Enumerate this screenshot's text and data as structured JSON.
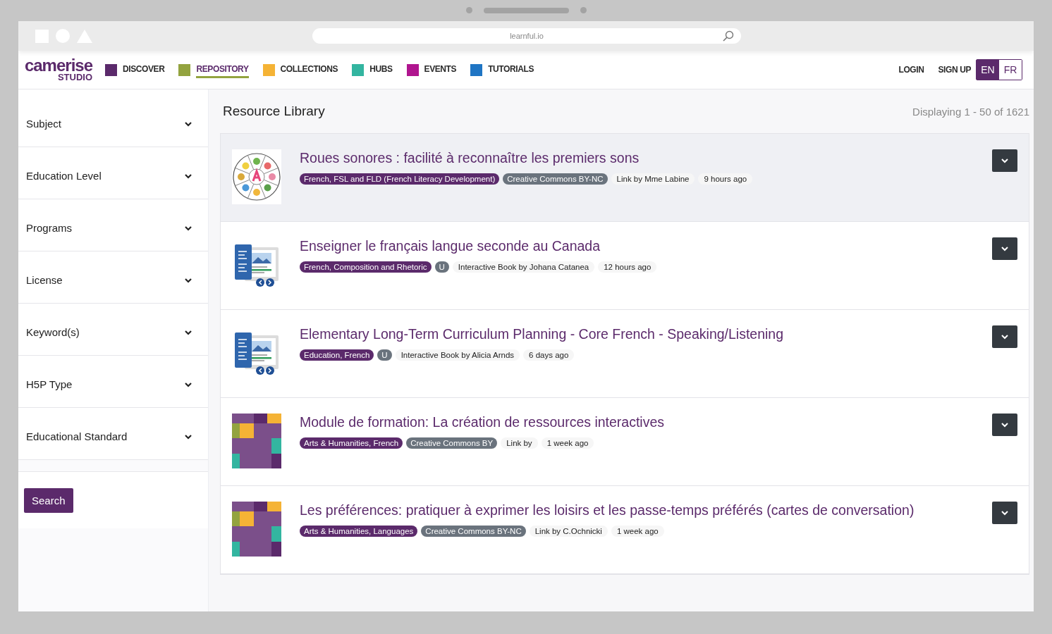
{
  "browser": {
    "address": "learnful.io"
  },
  "nav": {
    "logo": {
      "word": "camerise",
      "sub": "STUDIO"
    },
    "items": [
      {
        "label": "DISCOVER",
        "color": "#5b2a6b",
        "selected": false
      },
      {
        "label": "REPOSITORY",
        "color": "#93a33f",
        "selected": true
      },
      {
        "label": "COLLECTIONS",
        "color": "#f5b335",
        "selected": false
      },
      {
        "label": "HUBS",
        "color": "#33b5a0",
        "selected": false
      },
      {
        "label": "EVENTS",
        "color": "#b0158f",
        "selected": false
      },
      {
        "label": "TUTORIALS",
        "color": "#1f75c4",
        "selected": false
      }
    ],
    "account": [
      "LOGIN",
      "SIGN UP"
    ],
    "languages": [
      {
        "label": "EN",
        "selected": true
      },
      {
        "label": "FR",
        "selected": false
      }
    ]
  },
  "sidebar": {
    "filters": [
      "Subject",
      "Education Level",
      "Programs",
      "License",
      "Keyword(s)",
      "H5P Type",
      "Educational Standard"
    ],
    "button": "Search"
  },
  "main": {
    "title": "Resource Library",
    "count": "Displaying 1 - 50 of 1621",
    "results": [
      {
        "kind": "wheel",
        "highlighted": true,
        "title": "Roues sonores : facilité à reconnaître les premiers sons",
        "chips": [
          {
            "kind": "subject",
            "text": "French, FSL and FLD (French Literacy Development)"
          },
          {
            "kind": "license",
            "text": "Creative Commons BY-NC"
          },
          {
            "kind": "plain",
            "text": "Link by Mme Labine"
          },
          {
            "kind": "plain",
            "text": "9 hours ago"
          }
        ]
      },
      {
        "kind": "book",
        "highlighted": false,
        "title": "Enseigner le français langue seconde au Canada",
        "chips": [
          {
            "kind": "subject",
            "text": "French, Composition and Rhetoric"
          },
          {
            "kind": "license",
            "text": "U"
          },
          {
            "kind": "plain",
            "text": "Interactive Book by Johana Catanea"
          },
          {
            "kind": "plain",
            "text": "12 hours ago"
          }
        ]
      },
      {
        "kind": "book",
        "highlighted": false,
        "title": "Elementary Long-Term Curriculum Planning - Core French - Speaking/Listening",
        "chips": [
          {
            "kind": "subject",
            "text": "Education, French"
          },
          {
            "kind": "license",
            "text": "U"
          },
          {
            "kind": "plain",
            "text": "Interactive Book by Alicia Arnds"
          },
          {
            "kind": "plain",
            "text": "6 days ago"
          }
        ]
      },
      {
        "kind": "mosaic",
        "highlighted": false,
        "title": "Module de formation: La création de ressources interactives",
        "chips": [
          {
            "kind": "subject",
            "text": "Arts & Humanities, French"
          },
          {
            "kind": "license",
            "text": "Creative Commons BY"
          },
          {
            "kind": "plain",
            "text": "Link by"
          },
          {
            "kind": "plain",
            "text": "1 week ago"
          }
        ]
      },
      {
        "kind": "mosaic",
        "highlighted": false,
        "title": "Les préférences: pratiquer à exprimer les loisirs et les passe-temps préférés (cartes de conversation)",
        "chips": [
          {
            "kind": "subject",
            "text": "Arts & Humanities, Languages"
          },
          {
            "kind": "license",
            "text": "Creative Commons BY-NC"
          },
          {
            "kind": "plain",
            "text": "Link by C.Ochnicki"
          },
          {
            "kind": "plain",
            "text": "1 week ago"
          }
        ]
      }
    ]
  }
}
